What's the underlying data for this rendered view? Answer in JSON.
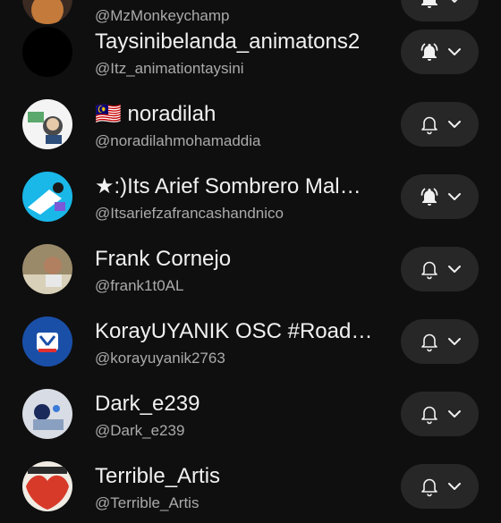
{
  "colors": {
    "background": "#0f0f0f",
    "button": "#272727",
    "primary_text": "#f1f1f1",
    "secondary_text": "#aaaaaa"
  },
  "channels": [
    {
      "name": "",
      "handle": "@MzMonkeychamp",
      "notify": "all"
    },
    {
      "name": "Taysinibelanda_animatons2",
      "handle": "@Itz_animationtaysini",
      "notify": "all"
    },
    {
      "name": "🇲🇾 noradilah",
      "handle": "@noradilahmohamadd­ia",
      "notify": "personalized"
    },
    {
      "name": "★:)Its Arief Sombrero Mal…",
      "handle": "@Itsariefzafrancashandnico",
      "notify": "all"
    },
    {
      "name": "Frank Cornejo",
      "handle": "@frank1t0AL",
      "notify": "personalized"
    },
    {
      "name": "KorayUYANIK OSC #RoadT…",
      "handle": "@korayuyanik2763",
      "notify": "personalized"
    },
    {
      "name": "Dark_e239",
      "handle": "@Dark_e239",
      "notify": "personalized"
    },
    {
      "name": "Terrible_Artis",
      "handle": "@Terrible_Artis",
      "notify": "personalized"
    }
  ]
}
